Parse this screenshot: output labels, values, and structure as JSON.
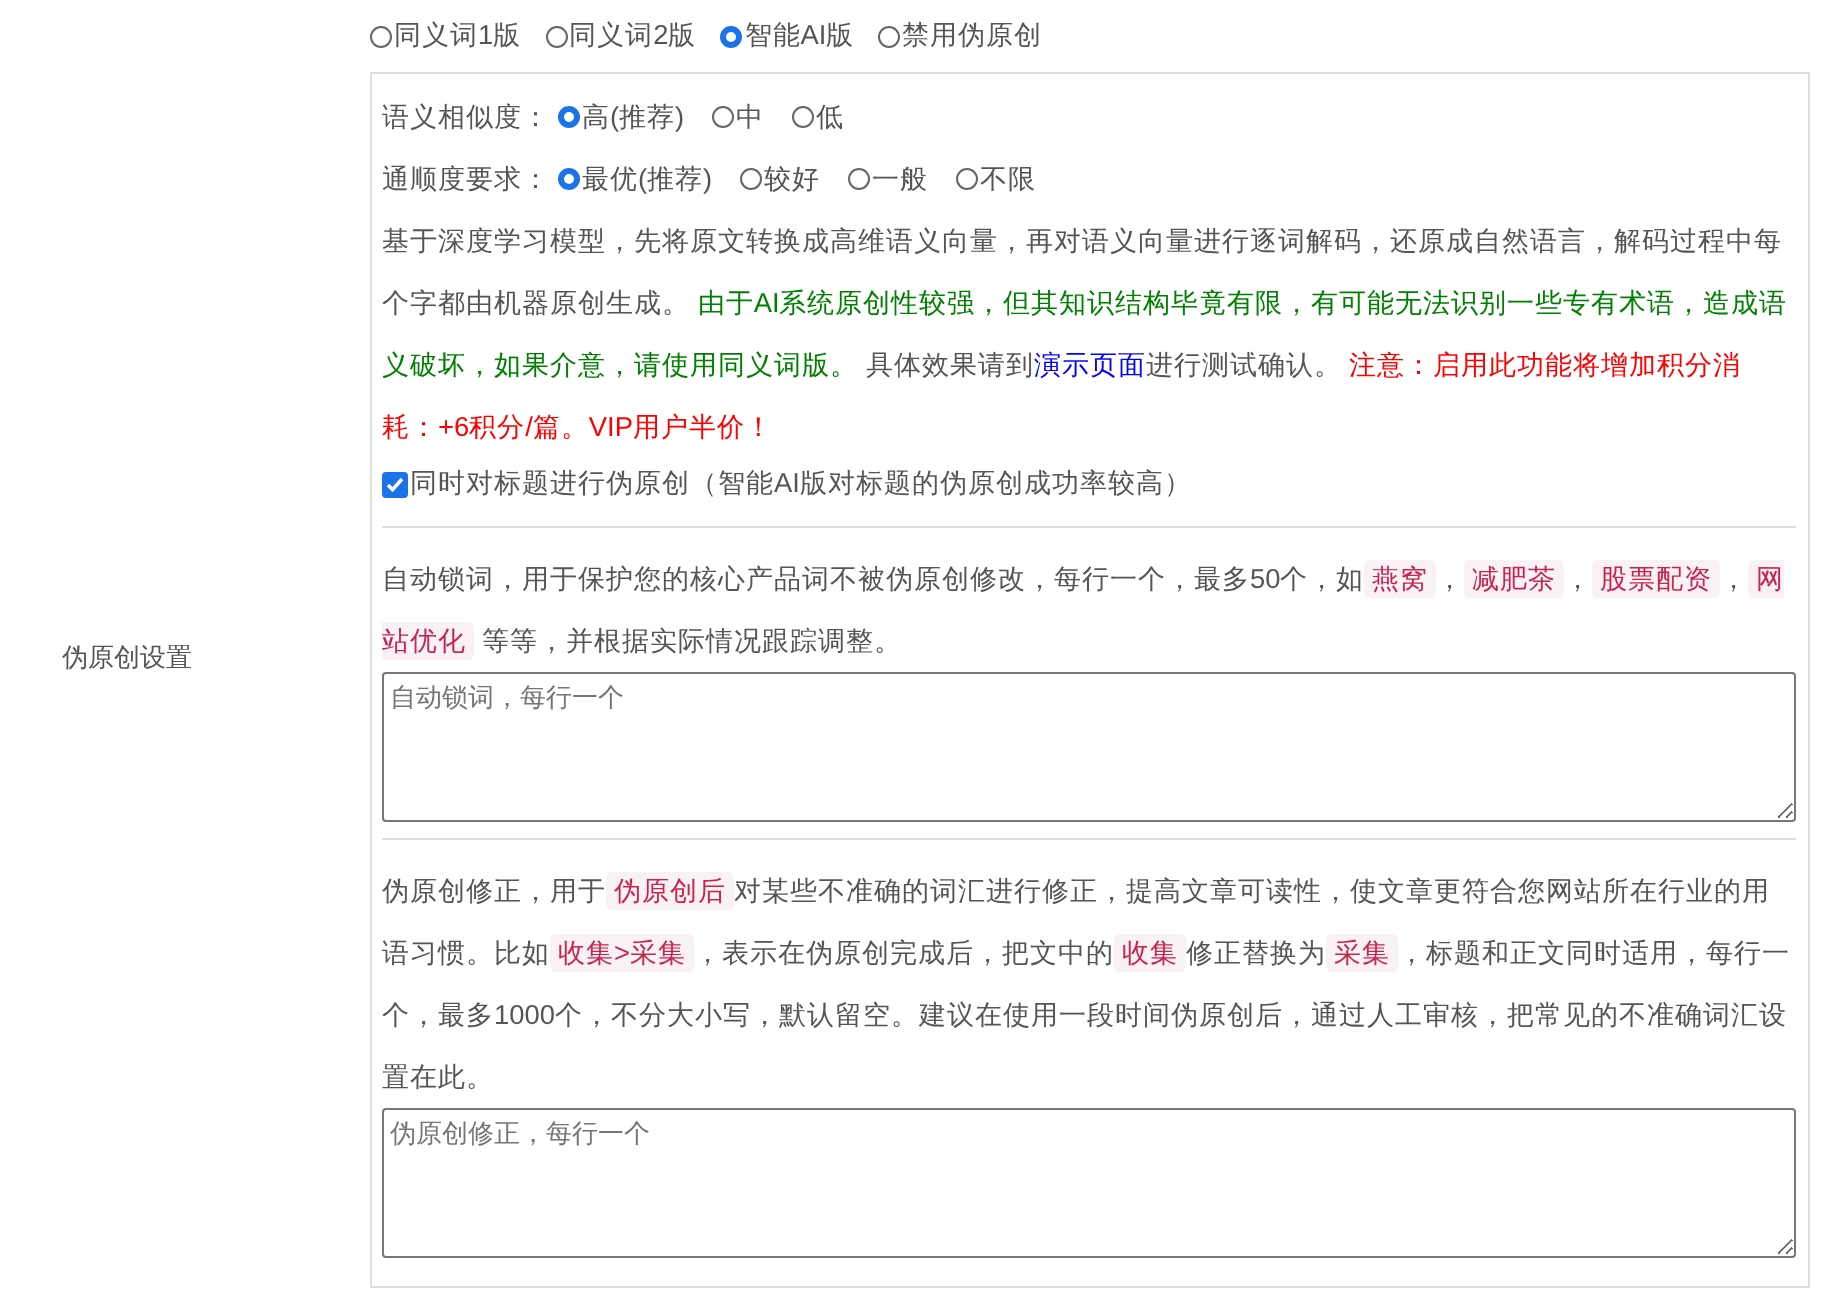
{
  "section_label": "伪原创设置",
  "modes": [
    {
      "label": "同义词1版",
      "selected": false
    },
    {
      "label": "同义词2版",
      "selected": false
    },
    {
      "label": "智能AI版",
      "selected": true
    },
    {
      "label": "禁用伪原创",
      "selected": false
    }
  ],
  "similarity": {
    "label": "语义相似度：",
    "options": [
      {
        "label": "高(推荐)",
        "selected": true
      },
      {
        "label": "中",
        "selected": false
      },
      {
        "label": "低",
        "selected": false
      }
    ]
  },
  "fluency": {
    "label": "通顺度要求：",
    "options": [
      {
        "label": "最优(推荐)",
        "selected": true
      },
      {
        "label": "较好",
        "selected": false
      },
      {
        "label": "一般",
        "selected": false
      },
      {
        "label": "不限",
        "selected": false
      }
    ]
  },
  "ai_description": [
    {
      "kind": "plain",
      "text": "基于深度学习模型，先将原文转换成高维语义向量，再对语义向量进行逐词解码，还原成自然语言，解码过程中每个字都由机器原创生成。 "
    },
    {
      "kind": "green",
      "text": "由于AI系统原创性较强，但其知识结构毕竟有限，有可能无法识别一些专有术语，造成语义破坏，如果介意，请使用同义词版。"
    },
    {
      "kind": "plain",
      "text": " 具体效果请到"
    },
    {
      "kind": "link",
      "text": "演示页面"
    },
    {
      "kind": "plain",
      "text": "进行测试确认。 "
    },
    {
      "kind": "red",
      "text": "注意：启用此功能将增加积分消耗：+6积分/篇。VIP用户半价！"
    }
  ],
  "title_rewrite": {
    "label": "同时对标题进行伪原创（智能AI版对标题的伪原创成功率较高）",
    "checked": true
  },
  "lock_words": {
    "description": [
      {
        "kind": "plain",
        "text": "自动锁词，用于保护您的核心产品词不被伪原创修改，每行一个，最多50个，如"
      },
      {
        "kind": "tag",
        "text": "燕窝"
      },
      {
        "kind": "plain",
        "text": "，"
      },
      {
        "kind": "tag",
        "text": "减肥茶"
      },
      {
        "kind": "plain",
        "text": "，"
      },
      {
        "kind": "tag",
        "text": "股票配资"
      },
      {
        "kind": "plain",
        "text": "，"
      },
      {
        "kind": "tag",
        "text": "网站优化"
      },
      {
        "kind": "plain",
        "text": " 等等，并根据实际情况跟踪调整。"
      }
    ],
    "placeholder": "自动锁词，每行一个"
  },
  "corrections": {
    "description": [
      {
        "kind": "plain",
        "text": "伪原创修正，用于"
      },
      {
        "kind": "tag",
        "text": "伪原创后"
      },
      {
        "kind": "plain",
        "text": "对某些不准确的词汇进行修正，提高文章可读性，使文章更符合您网站所在行业的用语习惯。比如"
      },
      {
        "kind": "tag",
        "text": "收集>采集"
      },
      {
        "kind": "plain",
        "text": "，表示在伪原创完成后，把文中的"
      },
      {
        "kind": "tag",
        "text": "收集"
      },
      {
        "kind": "plain",
        "text": "修正替换为"
      },
      {
        "kind": "tag",
        "text": "采集"
      },
      {
        "kind": "plain",
        "text": "，标题和正文同时适用，每行一个，最多1000个，不分大小写，默认留空。建议在使用一段时间伪原创后，通过人工审核，把常见的不准确词汇设置在此。"
      }
    ],
    "placeholder": "伪原创修正，每行一个"
  }
}
